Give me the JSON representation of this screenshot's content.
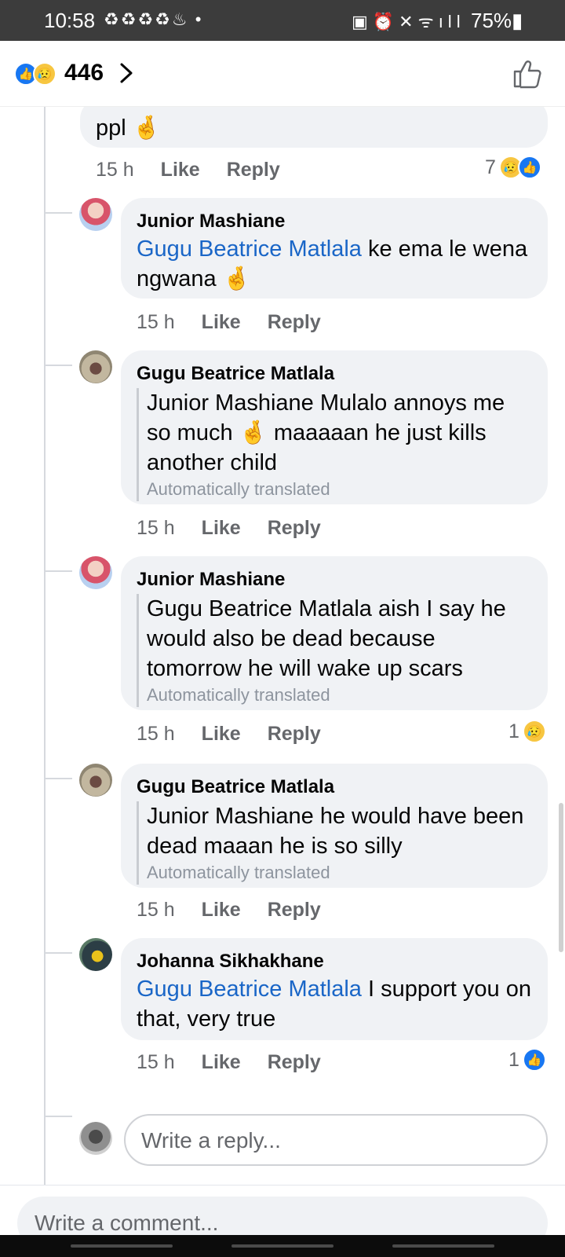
{
  "status_bar": {
    "time": "10:58",
    "left_icons": "♻♻♻♻♨ •",
    "right_icons": "▣⏰✕ᯤıll",
    "battery": "75%▮"
  },
  "reactions": {
    "count": "446",
    "emoji_like": "👍",
    "emoji_sad": "😥"
  },
  "comments": [
    {
      "text_fragment": "ppl 🤞",
      "time": "15 h",
      "like_label": "Like",
      "reply_label": "Reply",
      "reaction_count": "7"
    },
    {
      "author": "Junior Mashiane",
      "mention": "Gugu Beatrice Matlala",
      "text": " ke ema le wena ngwana  🤞",
      "time": "15 h",
      "like_label": "Like",
      "reply_label": "Reply"
    },
    {
      "author": "Gugu Beatrice Matlala",
      "text": "Junior Mashiane Mulalo annoys me so much 🤞 maaaaan he just kills another child",
      "auto_translated": "Automatically translated",
      "time": "15 h",
      "like_label": "Like",
      "reply_label": "Reply"
    },
    {
      "author": "Junior Mashiane",
      "text": "Gugu Beatrice Matlala aish I say he would also be dead because tomorrow he will wake up scars",
      "auto_translated": "Automatically translated",
      "time": "15 h",
      "like_label": "Like",
      "reply_label": "Reply",
      "reaction_count": "1"
    },
    {
      "author": "Gugu Beatrice Matlala",
      "text": "Junior Mashiane he would have been dead maaan he is so silly",
      "auto_translated": "Automatically translated",
      "time": "15 h",
      "like_label": "Like",
      "reply_label": "Reply"
    },
    {
      "author": "Johanna Sikhakhane",
      "mention": "Gugu Beatrice Matlala",
      "text": " I support you on that, very true",
      "time": "15 h",
      "like_label": "Like",
      "reply_label": "Reply",
      "reaction_count": "1"
    }
  ],
  "reply_input": {
    "placeholder": "Write a reply..."
  },
  "comment_input": {
    "placeholder": "Write a comment..."
  },
  "colors": {
    "accent": "#1877f2",
    "mention": "#1a66c7",
    "bubble": "#f0f2f5"
  }
}
